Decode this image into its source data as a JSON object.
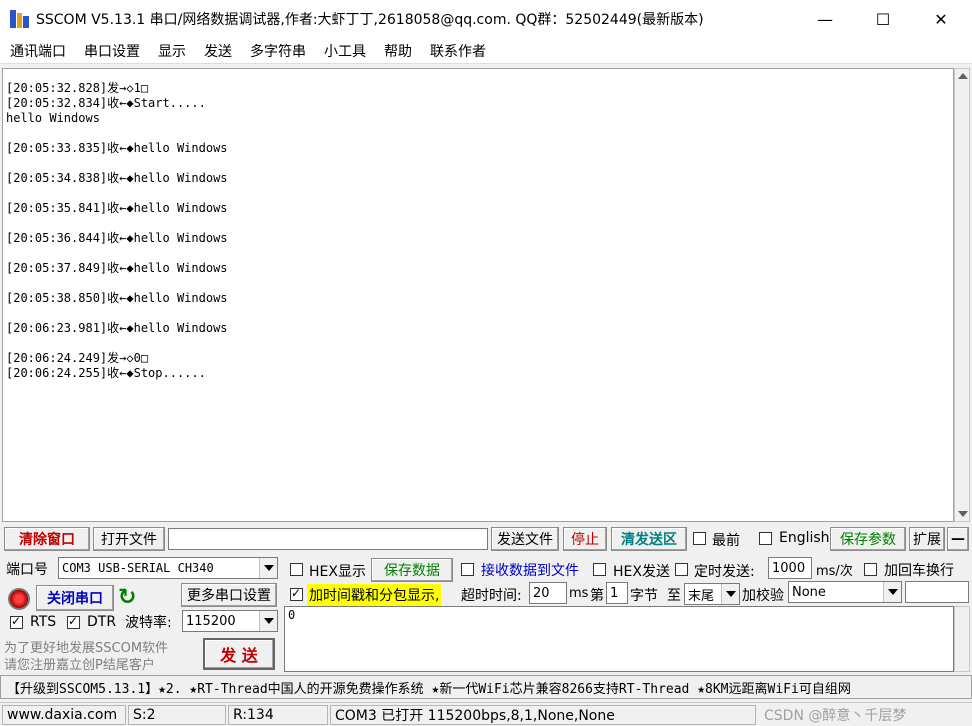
{
  "window": {
    "title": "SSCOM V5.13.1 串口/网络数据调试器,作者:大虾丁丁,2618058@qq.com. QQ群：52502449(最新版本)",
    "minimize_glyph": "—",
    "maximize_glyph": "☐",
    "close_glyph": "✕"
  },
  "menu": [
    "通讯端口",
    "串口设置",
    "显示",
    "发送",
    "多字符串",
    "小工具",
    "帮助",
    "联系作者"
  ],
  "receive_log": [
    "[20:05:32.828]发→◇1□",
    "[20:05:32.834]收←◆Start.....",
    "hello Windows",
    "",
    "[20:05:33.835]收←◆hello Windows",
    "",
    "[20:05:34.838]收←◆hello Windows",
    "",
    "[20:05:35.841]收←◆hello Windows",
    "",
    "[20:05:36.844]收←◆hello Windows",
    "",
    "[20:05:37.849]收←◆hello Windows",
    "",
    "[20:05:38.850]收←◆hello Windows",
    "",
    "[20:06:23.981]收←◆hello Windows",
    "",
    "[20:06:24.249]发→◇0□",
    "[20:06:24.255]收←◆Stop......"
  ],
  "toolbar": {
    "clear_window": "清除窗口",
    "open_file": "打开文件",
    "file_path": "",
    "send_file": "发送文件",
    "stop": "停止",
    "clear_send": "清发送区",
    "topmost": "最前",
    "english": "English",
    "save_params": "保存参数",
    "expand": "扩展",
    "collapse": "—"
  },
  "port": {
    "port_label": "端口号",
    "port_value": "COM3 USB-SERIAL CH340",
    "close_port": "关闭串口",
    "more_settings": "更多串口设置",
    "rts": "RTS",
    "dtr": "DTR",
    "baud_label": "波特率:",
    "baud_value": "115200",
    "promo_line1": "为了更好地发展SSCOM软件",
    "promo_line2": "请您注册嘉立创P结尾客户"
  },
  "options": {
    "hex_display": "HEX显示",
    "save_data": "保存数据",
    "recv_to_file": "接收数据到文件",
    "hex_send": "HEX发送",
    "timed_send": "定时发送:",
    "interval": "1000",
    "interval_unit": "ms/次",
    "add_crlf": "加回车换行",
    "timestamp": "加时间戳和分包显示,",
    "timeout_label": "超时时间:",
    "timeout_value": "20",
    "timeout_unit": "ms",
    "byte_prefix": "第",
    "byte_index": "1",
    "byte_label": "字节",
    "to_label": "至",
    "end_value": "末尾",
    "checksum_label": "加校验",
    "checksum_value": "None",
    "send_text": "0",
    "send_button": "发 送"
  },
  "marquee": "【升级到SSCOM5.13.1】★2. ★RT-Thread中国人的开源免费操作系统 ★新一代WiFi芯片兼容8266支持RT-Thread ★8KM远距离WiFi可自组网",
  "status": {
    "site": "www.daxia.com",
    "sent": "S:2",
    "received": "R:134",
    "port_state": "COM3 已打开  115200bps,8,1,None,None",
    "watermark": "CSDN @醉意丶千层梦"
  },
  "colors": {
    "highlight_yellow": "#ffff00",
    "accent_red": "#c00000",
    "accent_green": "#008000",
    "accent_blue": "#0000c0"
  }
}
